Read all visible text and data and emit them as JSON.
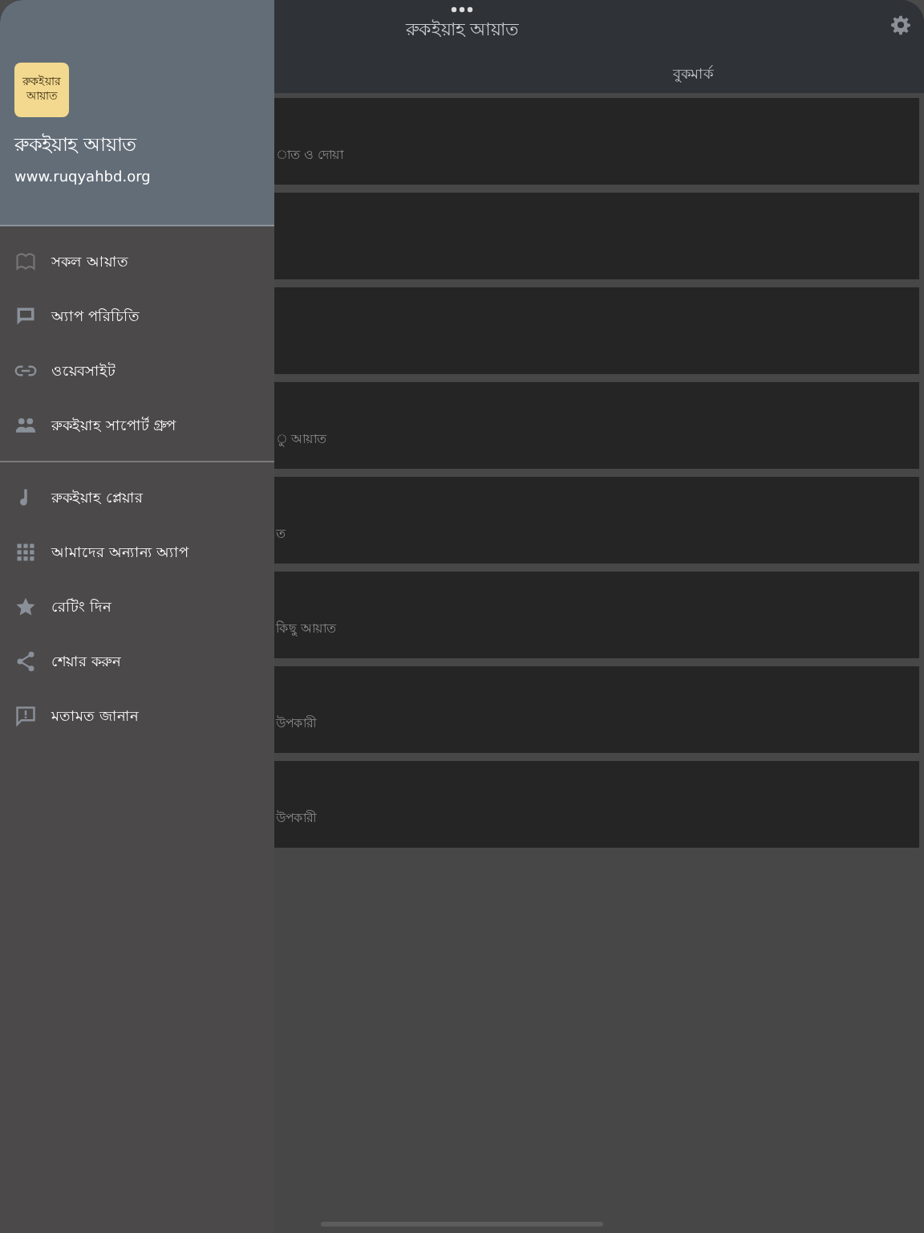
{
  "header": {
    "title": "রুকইয়াহ আয়াত"
  },
  "tabs": [
    {
      "label": "বুকমার্ক",
      "selected": false
    }
  ],
  "cards": [
    {
      "kind": "text",
      "subtitle": "াত ও দোয়া"
    },
    {
      "kind": "blank"
    },
    {
      "kind": "blank"
    },
    {
      "kind": "text",
      "subtitle": "ু আয়াত"
    },
    {
      "kind": "text",
      "subtitle": "ত"
    },
    {
      "kind": "text",
      "subtitle": "কিছু আয়াত"
    },
    {
      "kind": "text",
      "subtitle": "উপকারী"
    },
    {
      "kind": "text",
      "subtitle": "উপকারী"
    }
  ],
  "drawer": {
    "logo_lines": [
      "রুকইয়ার",
      "আয়াত"
    ],
    "title": "রুকইয়াহ আয়াত",
    "website": "www.ruqyahbd.org",
    "sections": [
      [
        {
          "label": "সকল আয়াত"
        },
        {
          "label": "অ্যাপ পরিচিতি"
        },
        {
          "label": "ওয়েবসাইট"
        },
        {
          "label": "রুকইয়াহ সাপোর্ট গ্রুপ"
        }
      ],
      [
        {
          "label": "রুকইয়াহ প্লেয়ার"
        },
        {
          "label": "আমাদের অন্যান্য অ্যাপ"
        },
        {
          "label": "রেটিং দিন"
        },
        {
          "label": "শেয়ার করুন"
        },
        {
          "label": "মতামত জানান"
        }
      ]
    ]
  }
}
